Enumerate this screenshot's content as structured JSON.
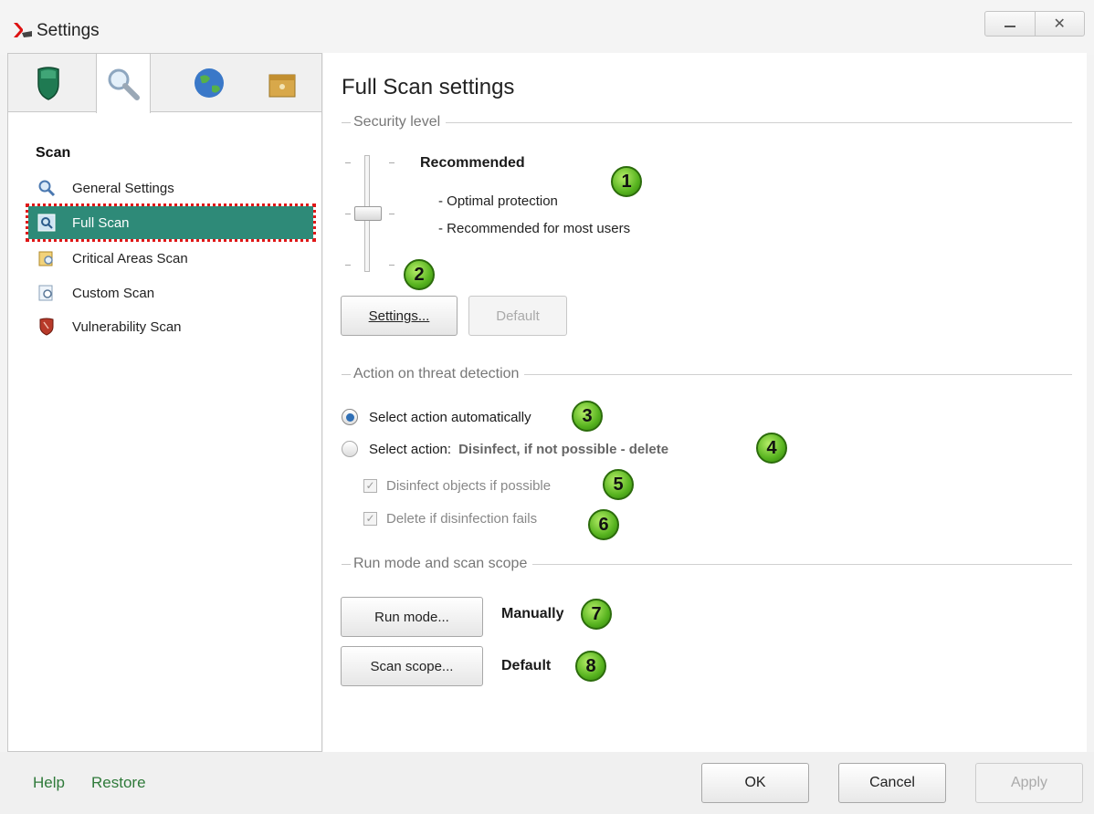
{
  "window": {
    "title": "Settings"
  },
  "sidebar": {
    "section_title": "Scan",
    "items": [
      {
        "label": "General Settings",
        "icon": "magnifier-icon"
      },
      {
        "label": "Full Scan",
        "icon": "full-scan-icon",
        "selected": true
      },
      {
        "label": "Critical Areas Scan",
        "icon": "critical-areas-icon"
      },
      {
        "label": "Custom Scan",
        "icon": "custom-scan-icon"
      },
      {
        "label": "Vulnerability Scan",
        "icon": "vulnerability-icon"
      }
    ]
  },
  "main": {
    "title": "Full Scan settings",
    "security_level": {
      "header": "Security level",
      "level_name": "Recommended",
      "desc": [
        "- Optimal protection",
        "- Recommended for most users"
      ],
      "settings_button": "Settings...",
      "default_button": "Default"
    },
    "threat": {
      "header": "Action on threat detection",
      "auto_label": "Select action automatically",
      "manual_label": "Select action:",
      "manual_value": "Disinfect, if not possible - delete",
      "disinfect_label": "Disinfect objects if possible",
      "delete_label": "Delete if disinfection fails"
    },
    "run": {
      "header": "Run mode and scan scope",
      "run_mode_button": "Run mode...",
      "run_mode_value": "Manually",
      "scope_button": "Scan scope...",
      "scope_value": "Default"
    },
    "badges": [
      "1",
      "2",
      "3",
      "4",
      "5",
      "6",
      "7",
      "8"
    ]
  },
  "footer": {
    "help": "Help",
    "restore": "Restore",
    "ok": "OK",
    "cancel": "Cancel",
    "apply": "Apply"
  },
  "colors": {
    "selected_bg": "#2e8a78",
    "link": "#2f7a3a",
    "badge": "#57b31f",
    "highlight_outline": "#e01818"
  }
}
